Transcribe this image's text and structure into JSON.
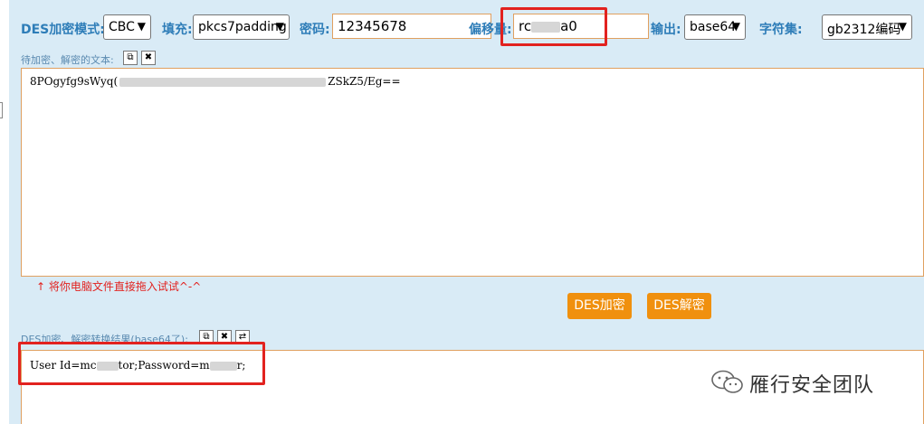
{
  "toolbar": {
    "mode_label": "DES加密模式:",
    "mode_value": "CBC",
    "padding_label": "填充:",
    "padding_value": "pkcs7padding",
    "key_label": "密码:",
    "key_value": "12345678",
    "iv_label": "偏移量:",
    "iv_prefix": "rc",
    "iv_suffix": "a0",
    "output_label": "输出:",
    "output_value": "base64",
    "charset_label": "字符集:",
    "charset_value": "gb2312编码"
  },
  "input_section": {
    "label": "待加密、解密的文本:",
    "text_prefix": "8POgyfg9sWyq(",
    "text_suffix": "ZSkZ5/Eg=="
  },
  "hint": "↑ 将你电脑文件直接拖入试试^-^",
  "buttons": {
    "encrypt": "DES加密",
    "decrypt": "DES解密"
  },
  "output_section": {
    "label": "DES加密、解密转换结果(base64了):",
    "text_prefix": "User Id=mc",
    "text_mid": "tor;Password=m",
    "text_suffix": "r;"
  },
  "watermark": {
    "text": "雁行安全团队"
  },
  "colors": {
    "panel_bg": "#d9ebf6",
    "label_blue": "#2e7db8",
    "input_border": "#e0a060",
    "button_orange": "#f0900e",
    "highlight_red": "#e2221f"
  }
}
